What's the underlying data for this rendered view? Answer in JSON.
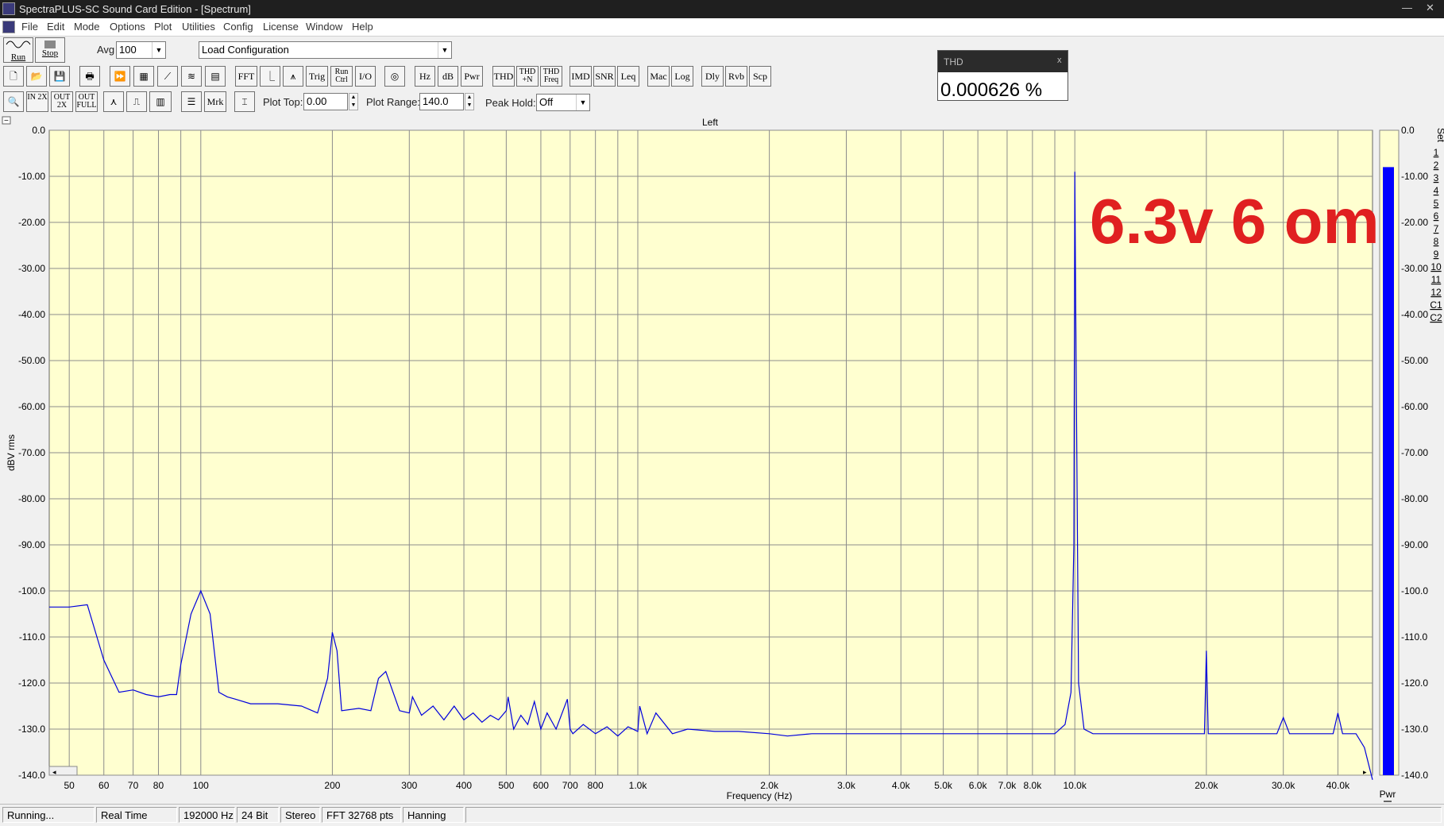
{
  "window": {
    "title": "SpectraPLUS-SC Sound Card Edition - [Spectrum]",
    "min_glyph": "—",
    "close_glyph": "✕"
  },
  "menu": [
    "File",
    "Edit",
    "Mode",
    "Options",
    "Plot",
    "Utilities",
    "Config",
    "License",
    "Window",
    "Help"
  ],
  "toolbar1": {
    "run_label": "Run",
    "stop_label": "Stop",
    "avg_label": "Avg",
    "avg_value": "100",
    "config_value": "Load Configuration"
  },
  "toolbar2": {
    "buttons": [
      "FFT",
      "Trig",
      "Run Ctrl",
      "I/O",
      "Hz",
      "dB",
      "Pwr",
      "THD",
      "THD +N",
      "THD Freq",
      "IMD",
      "SNR",
      "Leq",
      "Mac",
      "Log",
      "Dly",
      "Rvb",
      "Scp"
    ]
  },
  "toolbar3": {
    "zoom_buttons": [
      "IN 2X",
      "OUT 2X",
      "OUT FULL"
    ],
    "mrk_label": "Mrk",
    "plot_top_label": "Plot Top:",
    "plot_top_value": "0.00",
    "plot_range_label": "Plot Range:",
    "plot_range_value": "140.0",
    "peak_hold_label": "Peak Hold:",
    "peak_hold_value": "Off"
  },
  "thd_window": {
    "title": "THD",
    "close": "x",
    "value": "0.000626 %"
  },
  "plot": {
    "collapse_glyph": "−",
    "set_label": "Set",
    "set_items": [
      "1",
      "2",
      "3",
      "4",
      "5",
      "6",
      "7",
      "8",
      "9",
      "10",
      "11",
      "12",
      "C1",
      "C2"
    ],
    "meter_label": "Pwr",
    "meter_value_db": -8.0,
    "annotation": "6.3v 6 om",
    "annotation_color": "#e02020",
    "trace_color": "#0000dd",
    "background": "#ffffd0"
  },
  "chart_data": {
    "type": "line",
    "title": "Left",
    "xlabel": "Frequency (Hz)",
    "ylabel": "dBV rms",
    "x_scale": "log",
    "xlim": [
      45,
      48000
    ],
    "ylim": [
      -140,
      0
    ],
    "grid": true,
    "x_tick_labels": [
      {
        "v": 50,
        "t": "50"
      },
      {
        "v": 60,
        "t": "60"
      },
      {
        "v": 70,
        "t": "70"
      },
      {
        "v": 80,
        "t": "80"
      },
      {
        "v": 100,
        "t": "100"
      },
      {
        "v": 200,
        "t": "200"
      },
      {
        "v": 300,
        "t": "300"
      },
      {
        "v": 400,
        "t": "400"
      },
      {
        "v": 500,
        "t": "500"
      },
      {
        "v": 600,
        "t": "600"
      },
      {
        "v": 700,
        "t": "700"
      },
      {
        "v": 800,
        "t": "800"
      },
      {
        "v": 1000,
        "t": "1.0k"
      },
      {
        "v": 2000,
        "t": "2.0k"
      },
      {
        "v": 3000,
        "t": "3.0k"
      },
      {
        "v": 4000,
        "t": "4.0k"
      },
      {
        "v": 5000,
        "t": "5.0k"
      },
      {
        "v": 6000,
        "t": "6.0k"
      },
      {
        "v": 7000,
        "t": "7.0k"
      },
      {
        "v": 8000,
        "t": "8.0k"
      },
      {
        "v": 10000,
        "t": "10.0k"
      },
      {
        "v": 20000,
        "t": "20.0k"
      },
      {
        "v": 30000,
        "t": "30.0k"
      },
      {
        "v": 40000,
        "t": "40.0k"
      }
    ],
    "y_ticks": [
      0,
      -10,
      -20,
      -30,
      -40,
      -50,
      -60,
      -70,
      -80,
      -90,
      -100,
      -110,
      -120,
      -130,
      -140
    ],
    "y_tick_labels": [
      "0.0",
      "-10.00",
      "-20.00",
      "-30.00",
      "-40.00",
      "-50.00",
      "-60.00",
      "-70.00",
      "-80.00",
      "-90.00",
      "-100.0",
      "-110.0",
      "-120.0",
      "-130.0",
      "-140.0"
    ],
    "series": [
      {
        "x": [
          45,
          50,
          55,
          60,
          65,
          70,
          75,
          80,
          85,
          88,
          90,
          95,
          100,
          105,
          110,
          115,
          120,
          130,
          150,
          170,
          185,
          195,
          200,
          205,
          210,
          230,
          245,
          255,
          265,
          285,
          300,
          305,
          320,
          340,
          360,
          380,
          400,
          420,
          440,
          460,
          480,
          500,
          505,
          520,
          540,
          560,
          580,
          600,
          620,
          650,
          690,
          700,
          710,
          750,
          800,
          850,
          900,
          950,
          1000,
          1010,
          1050,
          1100,
          1200,
          1300,
          1500,
          1700,
          2000,
          2200,
          2500,
          3000,
          3500,
          4000,
          5000,
          6000,
          7000,
          8000,
          9000,
          9500,
          9800,
          9950,
          10000,
          10050,
          10200,
          10500,
          11000,
          13000,
          16000,
          19000,
          19800,
          20000,
          20200,
          21000,
          25000,
          29000,
          30000,
          31000,
          35000,
          39000,
          40000,
          41000,
          44000,
          46000,
          48000
        ],
        "y": [
          -103.5,
          -103.5,
          -103,
          -115,
          -122,
          -121.5,
          -122.5,
          -123,
          -122.5,
          -122.5,
          -116,
          -105,
          -100,
          -105,
          -122,
          -123,
          -123.5,
          -124.5,
          -124.5,
          -125,
          -126.5,
          -119,
          -109,
          -113,
          -126,
          -125.5,
          -126,
          -119,
          -117.5,
          -126,
          -126.5,
          -123,
          -127,
          -125,
          -128,
          -125,
          -128,
          -126.5,
          -128.5,
          -127,
          -128,
          -126,
          -123,
          -130,
          -127,
          -129,
          -124,
          -130,
          -126.5,
          -130,
          -123.5,
          -130,
          -131,
          -129,
          -131,
          -129.5,
          -131.5,
          -129.5,
          -130.5,
          -125,
          -131,
          -126.5,
          -131,
          -130,
          -130.5,
          -130.5,
          -131,
          -131.5,
          -131,
          -131,
          -131,
          -131,
          -131,
          -131,
          -131,
          -131,
          -131,
          -129,
          -122,
          -90,
          -9,
          -40,
          -120,
          -130,
          -131,
          -131,
          -131,
          -131,
          -131,
          -113,
          -131,
          -131,
          -131,
          -131,
          -127.5,
          -131,
          -131,
          -131,
          -126.5,
          -131,
          -131,
          -134,
          -141
        ]
      }
    ]
  }
}
